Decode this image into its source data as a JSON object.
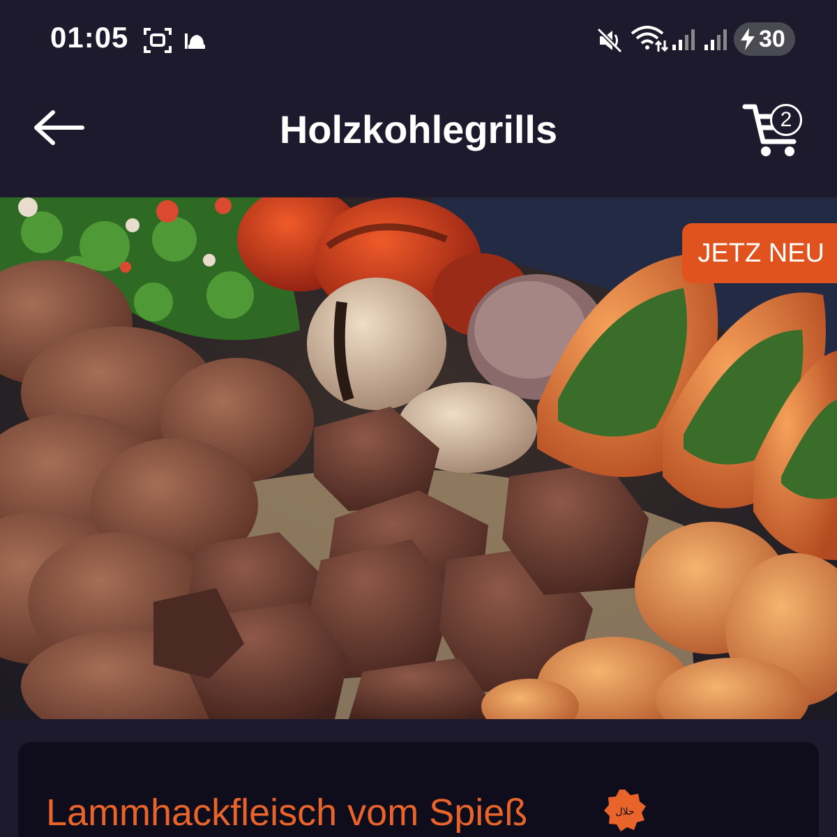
{
  "status_bar": {
    "time": "01:05",
    "battery_level": "30",
    "icons": [
      "screen-record-icon",
      "mosque-icon",
      "mute-icon",
      "wifi-icon",
      "signal-icon",
      "signal-icon",
      "charging-icon"
    ]
  },
  "app_bar": {
    "title": "Holzkohlegrills",
    "back_icon": "arrow-left-icon",
    "cart_icon": "cart-icon",
    "cart_count": "2"
  },
  "hero": {
    "badge_label": "JETZ NEU"
  },
  "product": {
    "name": "Lammhackfleisch vom Spieß",
    "halal_label": "حلال"
  },
  "colors": {
    "background": "#1c1a2c",
    "card": "#0f0d1c",
    "accent": "#e8642a",
    "badge": "#e0531f"
  }
}
